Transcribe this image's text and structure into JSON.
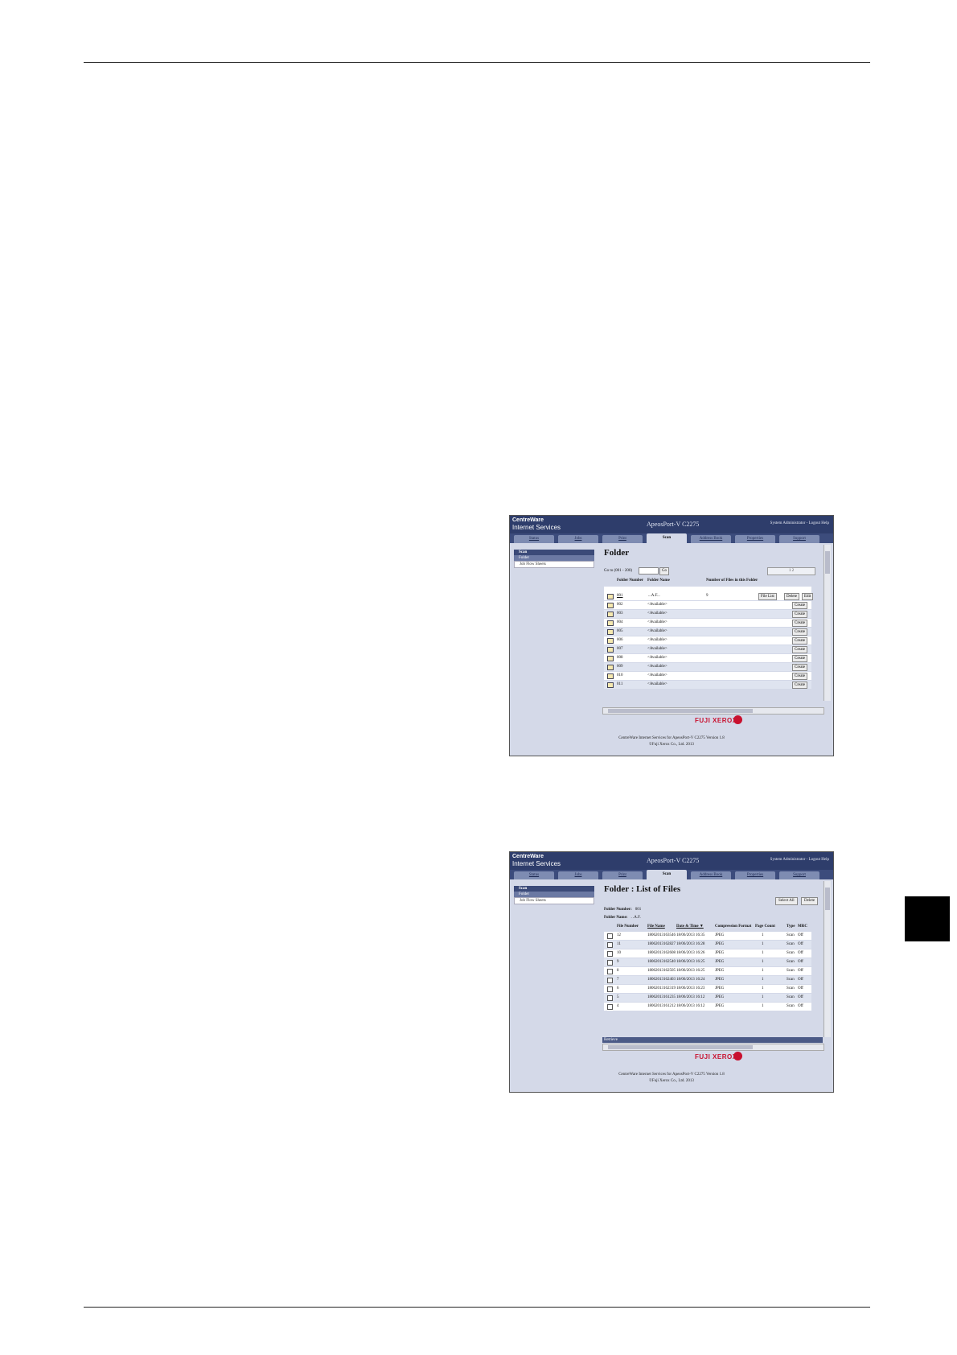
{
  "screens": {
    "common": {
      "brand_line1": "CentreWare",
      "brand_line2": "Internet Services",
      "model": "ApeosPort-V C2275",
      "admin": "System Administrator  - Logout Help",
      "tabs": [
        "Status",
        "Jobs",
        "Print",
        "Scan",
        "Address Book",
        "Properties",
        "Support"
      ],
      "active_tab": "Scan",
      "nav_head": "Scan",
      "nav_items": [
        "Folder",
        "Job Flow Sheets"
      ],
      "logo": "FUJI XEROX",
      "footer_line1": "CentreWare Internet Services for ApeosPort-V C2275 Version 1.8",
      "footer_line2": "©Fuji Xerox Co., Ltd. 2013"
    },
    "folder": {
      "title": "Folder",
      "goto_label": "Go to (001 - 200)",
      "go_button": "Go",
      "pager": "1 2",
      "col_number": "Folder Number",
      "col_name": "Folder Name",
      "col_files": "Number of Files in this Folder",
      "first_row": {
        "number": "001",
        "name": "...A.F...",
        "files": "9",
        "buttons": [
          "File List",
          "Delete",
          "Edit"
        ]
      },
      "rows": [
        {
          "number": "002",
          "name": "<Available>"
        },
        {
          "number": "003",
          "name": "<Available>"
        },
        {
          "number": "004",
          "name": "<Available>"
        },
        {
          "number": "005",
          "name": "<Available>"
        },
        {
          "number": "006",
          "name": "<Available>"
        },
        {
          "number": "007",
          "name": "<Available>"
        },
        {
          "number": "008",
          "name": "<Available>"
        },
        {
          "number": "009",
          "name": "<Available>"
        },
        {
          "number": "010",
          "name": "<Available>"
        },
        {
          "number": "011",
          "name": "<Available>"
        }
      ],
      "create_label": "Create"
    },
    "files": {
      "title": "Folder : List of Files",
      "select_all": "Select All",
      "delete": "Delete",
      "folder_number_label": "Folder Number:",
      "folder_number": "001",
      "folder_name_label": "Folder Name:",
      "folder_name": ". .A.F.",
      "columns": [
        "File Number",
        "File Name",
        "Date & Time ▼",
        "Compression Format",
        "Page Count",
        "Type",
        "MRC High"
      ],
      "rows": [
        {
          "num": "12",
          "name": "18062013163546",
          "date": "18/06/2013 16:35",
          "fmt": "JPEG",
          "pages": "1",
          "type": "Scan",
          "mrc": "Off"
        },
        {
          "num": "11",
          "name": "18062013162827",
          "date": "18/06/2013 16:28",
          "fmt": "JPEG",
          "pages": "1",
          "type": "Scan",
          "mrc": "Off"
        },
        {
          "num": "10",
          "name": "18062013162608",
          "date": "18/06/2013 16:26",
          "fmt": "JPEG",
          "pages": "1",
          "type": "Scan",
          "mrc": "Off"
        },
        {
          "num": "9",
          "name": "18062013162540",
          "date": "18/06/2013 16:25",
          "fmt": "JPEG",
          "pages": "1",
          "type": "Scan",
          "mrc": "Off"
        },
        {
          "num": "8",
          "name": "18062013162505",
          "date": "18/06/2013 16:25",
          "fmt": "JPEG",
          "pages": "1",
          "type": "Scan",
          "mrc": "Off"
        },
        {
          "num": "7",
          "name": "18062013162403",
          "date": "18/06/2013 16:24",
          "fmt": "JPEG",
          "pages": "1",
          "type": "Scan",
          "mrc": "Off"
        },
        {
          "num": "6",
          "name": "18062013162319",
          "date": "18/06/2013 16:23",
          "fmt": "JPEG",
          "pages": "1",
          "type": "Scan",
          "mrc": "Off"
        },
        {
          "num": "5",
          "name": "18062013161235",
          "date": "18/06/2013 16:12",
          "fmt": "JPEG",
          "pages": "1",
          "type": "Scan",
          "mrc": "Off"
        },
        {
          "num": "4",
          "name": "18062013161212",
          "date": "18/06/2013 16:12",
          "fmt": "JPEG",
          "pages": "1",
          "type": "Scan",
          "mrc": "Off"
        }
      ],
      "review_label": "Retrieve"
    }
  }
}
